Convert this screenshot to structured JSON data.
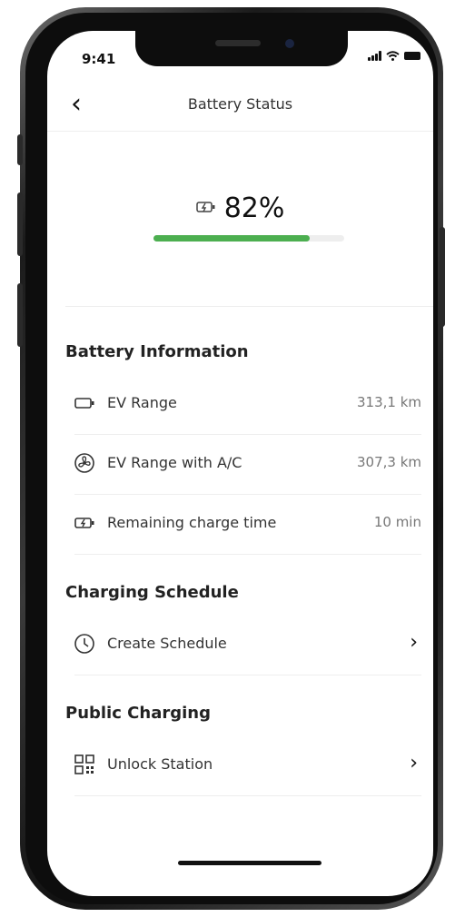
{
  "status_bar": {
    "time": "9:41"
  },
  "header": {
    "title": "Battery Status"
  },
  "battery": {
    "percent_text": "82%",
    "level": 0.82,
    "icon": "battery-charging-icon"
  },
  "battery_information": {
    "title": "Battery Information",
    "rows": [
      {
        "label": "EV Range",
        "value": "313,1 km",
        "icon": "battery-icon"
      },
      {
        "label": "EV Range with A/C",
        "value": "307,3 km",
        "icon": "fan-icon"
      },
      {
        "label": "Remaining charge time",
        "value": "10 min",
        "icon": "battery-charging-icon"
      }
    ]
  },
  "charging_schedule": {
    "title": "Charging Schedule",
    "create_label": "Create Schedule",
    "icon": "clock-icon"
  },
  "public_charging": {
    "title": "Public Charging",
    "unlock_label": "Unlock Station",
    "icon": "qr-code-icon"
  },
  "colors": {
    "accent": "#4caf50",
    "track": "#eeeeee",
    "text": "#222222",
    "muted": "#777777"
  }
}
